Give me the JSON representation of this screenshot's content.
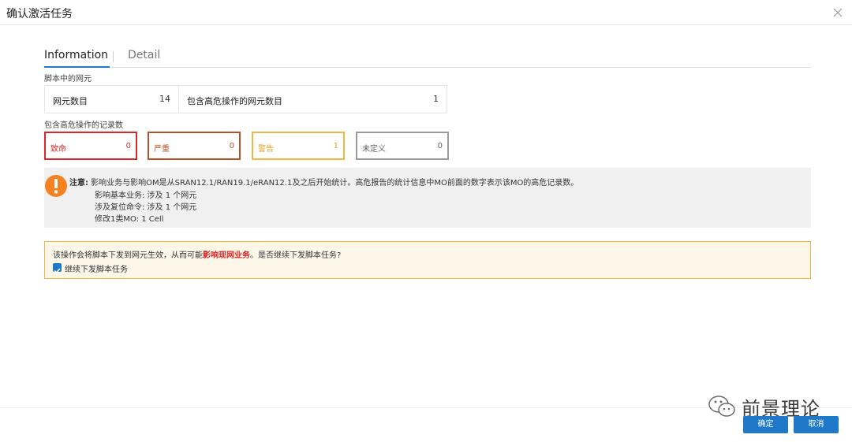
{
  "dialog": {
    "title": "确认激活任务"
  },
  "tabs": [
    {
      "label": "Information",
      "active": true
    },
    {
      "label": "Detail",
      "active": false
    }
  ],
  "ne_section": {
    "label": "脚本中的网元",
    "items": [
      {
        "label": "网元数目",
        "value": "14"
      },
      {
        "label": "包含高危操作的网元数目",
        "value": "1"
      }
    ]
  },
  "record_section": {
    "label": "包含高危操作的记录数",
    "levels": [
      {
        "label": "致命",
        "value": "0",
        "color": "#d9282a"
      },
      {
        "label": "严重",
        "value": "0",
        "color": "#b65227"
      },
      {
        "label": "警告",
        "value": "1",
        "color": "#f2b541"
      },
      {
        "label": "未定义",
        "value": "0",
        "color": "#9a9a9a"
      }
    ]
  },
  "notice": {
    "icon": "exclamation-icon",
    "icon_color": "#f58220",
    "prefix": "注意:",
    "main_text": "影响业务与影响OM是从SRAN12.1/RAN19.1/eRAN12.1及之后开始统计。高危报告的统计信息中MO前面的数字表示该MO的高危记录数。",
    "lines": [
      "影响基本业务: 涉及 1 个网元",
      "涉及复位命令: 涉及 1 个网元",
      "修改1类MO: 1 Cell"
    ]
  },
  "confirm": {
    "text_before": "该操作会将脚本下发到网元生效，从而可能",
    "text_highlight": "影响现网业务",
    "text_after": "。是否继续下发脚本任务?",
    "checkbox_label": "继续下发脚本任务",
    "checked": true
  },
  "watermark": {
    "text": "前景理论",
    "icon": "wechat-icon"
  },
  "buttons": {
    "ok": "确定",
    "cancel": "取消"
  },
  "colors": {
    "primary": "#1f78c8",
    "warning_border": "#f2b541",
    "danger": "#d9282a"
  }
}
